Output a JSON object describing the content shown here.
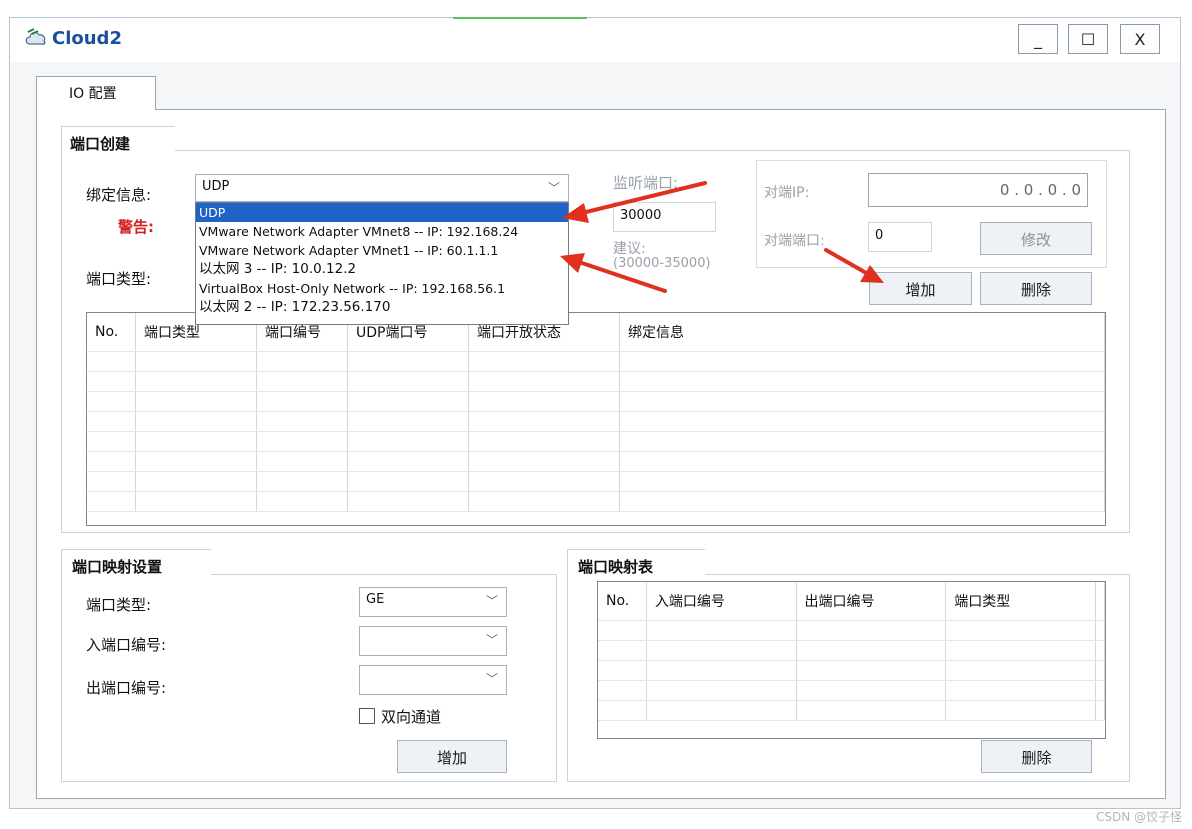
{
  "window": {
    "title": "Cloud2",
    "minimize": "_",
    "maximize": "☐",
    "close": "X"
  },
  "tabs": [
    {
      "label": "IO 配置"
    }
  ],
  "port_create": {
    "group_title": "端口创建",
    "bind_label": "绑定信息:",
    "bind_value": "UDP",
    "warning_label": "警告:",
    "port_type_label": "端口类型:",
    "listen_port_label": "监听端口:",
    "listen_port_value": "30000",
    "suggest_label": "建议:",
    "suggest_range": "(30000-35000)",
    "peer_ip_label": "对端IP:",
    "peer_ip_value": "0   .   0   .   0   .   0",
    "peer_port_label": "对端端口:",
    "peer_port_value": "0",
    "modify_button": "修改",
    "add_button": "增加",
    "delete_button": "删除",
    "dropdown_options": [
      "UDP",
      "VMware Network Adapter VMnet8 -- IP: 192.168.24",
      "VMware Network Adapter VMnet1 -- IP: 60.1.1.1",
      "以太网 3 -- IP: 10.0.12.2",
      "VirtualBox Host-Only Network -- IP: 192.168.56.1",
      "以太网 2 -- IP: 172.23.56.170"
    ],
    "table_headers": [
      "No.",
      "端口类型",
      "端口编号",
      "UDP端口号",
      "端口开放状态",
      "绑定信息"
    ]
  },
  "port_mapping_settings": {
    "group_title": "端口映射设置",
    "port_type_label": "端口类型:",
    "port_type_value": "GE",
    "in_port_label": "入端口编号:",
    "out_port_label": "出端口编号:",
    "bidirectional_label": "双向通道",
    "add_button": "增加"
  },
  "port_mapping_table": {
    "group_title": "端口映射表",
    "headers": [
      "No.",
      "入端口编号",
      "出端口编号",
      "端口类型"
    ],
    "delete_button": "删除"
  },
  "watermark": "CSDN @饺子怪",
  "colors": {
    "selection": "#1f63c6",
    "warning": "#d32020",
    "arrow": "#e0301e",
    "title": "#1a4fa0"
  }
}
